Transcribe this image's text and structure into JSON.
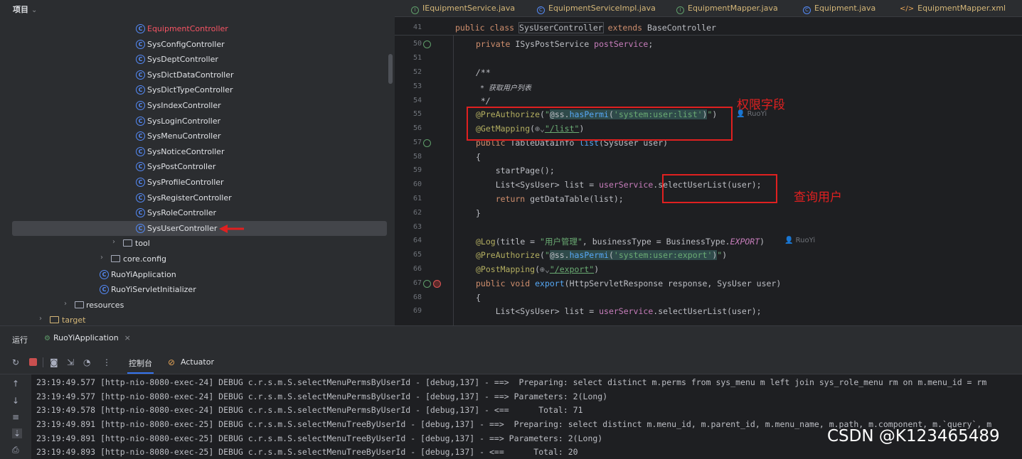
{
  "project": {
    "header": "项目",
    "items": [
      {
        "label": "EquipmentController",
        "kind": "class",
        "highlight": true
      },
      {
        "label": "SysConfigController",
        "kind": "class"
      },
      {
        "label": "SysDeptController",
        "kind": "class"
      },
      {
        "label": "SysDictDataController",
        "kind": "class"
      },
      {
        "label": "SysDictTypeController",
        "kind": "class"
      },
      {
        "label": "SysIndexController",
        "kind": "class"
      },
      {
        "label": "SysLoginController",
        "kind": "class"
      },
      {
        "label": "SysMenuController",
        "kind": "class"
      },
      {
        "label": "SysNoticeController",
        "kind": "class"
      },
      {
        "label": "SysPostController",
        "kind": "class"
      },
      {
        "label": "SysProfileController",
        "kind": "class"
      },
      {
        "label": "SysRegisterController",
        "kind": "class"
      },
      {
        "label": "SysRoleController",
        "kind": "class"
      },
      {
        "label": "SysUserController",
        "kind": "class",
        "selected": true
      },
      {
        "label": "tool",
        "kind": "folder"
      },
      {
        "label": "core.config",
        "kind": "folder"
      },
      {
        "label": "RuoYiApplication",
        "kind": "class"
      },
      {
        "label": "RuoYiServletInitializer",
        "kind": "class"
      },
      {
        "label": "resources",
        "kind": "folder"
      },
      {
        "label": "target",
        "kind": "folder"
      }
    ]
  },
  "editor": {
    "tabs": [
      {
        "label": "IEquipmentService.java",
        "icon": "interface-icon"
      },
      {
        "label": "EquipmentServiceImpl.java",
        "icon": "class-icon"
      },
      {
        "label": "EquipmentMapper.java",
        "icon": "interface-icon"
      },
      {
        "label": "Equipment.java",
        "icon": "class-icon"
      },
      {
        "label": "EquipmentMapper.xml",
        "icon": "xml-icon"
      }
    ],
    "sticky": {
      "line": "41",
      "kw1": "public class ",
      "cls": "SysUserController",
      "kw2": " extends ",
      "base": "BaseController"
    },
    "lines": {
      "l50": {
        "n": "50",
        "kw": "private ",
        "rest": "ISysPostService ",
        "fld": "postService",
        "end": ";"
      },
      "l51": {
        "n": "51"
      },
      "l52": {
        "n": "52",
        "text": "/**"
      },
      "l53": {
        "n": "53",
        "text": " * 获取用户列表"
      },
      "l54": {
        "n": "54",
        "text": " */"
      },
      "l55": {
        "n": "55",
        "an": "@PreAuthorize",
        "p1": "(",
        "q1": "\"",
        "ref": "@ss.",
        "fn": "hasPermi",
        "p2": "(",
        "str": "'system:user:list'",
        "p3": ")",
        "q2": "\"",
        "p4": ")",
        "author": "RuoYi"
      },
      "l56": {
        "n": "56",
        "an": "@GetMapping",
        "p1": "(",
        "globe": "⊕⌄",
        "str": "\"/list\"",
        "p2": ")"
      },
      "l57": {
        "n": "57",
        "kw": "public ",
        "rest": "TableDataInfo ",
        "fn": "list",
        "args": "(SysUser user)"
      },
      "l58": {
        "n": "58",
        "text": "{"
      },
      "l59": {
        "n": "59",
        "text": "    startPage();"
      },
      "l60": {
        "n": "60",
        "pre": "    List<SysUser> list = ",
        "fld": "userService",
        "call": ".selectUserList(user);"
      },
      "l61": {
        "n": "61",
        "kw": "    return ",
        "rest": "getDataTable(list);"
      },
      "l62": {
        "n": "62",
        "text": "}"
      },
      "l63": {
        "n": "63"
      },
      "l64": {
        "n": "64",
        "an": "@Log",
        "p1": "(title = ",
        "str": "\"用户管理\"",
        "p2": ", businessType = BusinessType.",
        "it": "EXPORT",
        "p3": ")",
        "author": "RuoYi"
      },
      "l65": {
        "n": "65",
        "an": "@PreAuthorize",
        "p1": "(",
        "q1": "\"",
        "ref": "@ss.",
        "fn": "hasPermi",
        "p2": "(",
        "str": "'system:user:export'",
        "p3": ")",
        "q2": "\"",
        "p4": ")"
      },
      "l66": {
        "n": "66",
        "an": "@PostMapping",
        "p1": "(",
        "globe": "⊕⌄",
        "str": "\"/export\"",
        "p2": ")"
      },
      "l67": {
        "n": "67",
        "kw": "public void ",
        "fn": "export",
        "args": "(HttpServletResponse response, SysUser user)"
      },
      "l68": {
        "n": "68",
        "text": "{"
      },
      "l69": {
        "n": "69",
        "pre": "    List<SysUser> list = ",
        "fld": "userService",
        "call": ".selectUserList(user);"
      }
    },
    "annotations": {
      "perm": "权限字段",
      "query": "查询用户"
    }
  },
  "run": {
    "title": "运行",
    "tab": "RuoYiApplication",
    "close": "×",
    "console": "控制台",
    "actuator": "Actuator",
    "logs": [
      "23:19:49.577 [http-nio-8080-exec-24] DEBUG c.r.s.m.S.selectMenuPermsByUserId - [debug,137] - ==>  Preparing: select distinct m.perms from sys_menu m left join sys_role_menu rm on m.menu_id = rm",
      "23:19:49.577 [http-nio-8080-exec-24] DEBUG c.r.s.m.S.selectMenuPermsByUserId - [debug,137] - ==> Parameters: 2(Long)",
      "23:19:49.578 [http-nio-8080-exec-24] DEBUG c.r.s.m.S.selectMenuPermsByUserId - [debug,137] - <==      Total: 71",
      "23:19:49.891 [http-nio-8080-exec-25] DEBUG c.r.s.m.S.selectMenuTreeByUserId - [debug,137] - ==>  Preparing: select distinct m.menu_id, m.parent_id, m.menu_name, m.path, m.component, m.`query`, m",
      "23:19:49.891 [http-nio-8080-exec-25] DEBUG c.r.s.m.S.selectMenuTreeByUserId - [debug,137] - ==> Parameters: 2(Long)",
      "23:19:49.893 [http-nio-8080-exec-25] DEBUG c.r.s.m.S.selectMenuTreeByUserId - [debug,137] - <==      Total: 20"
    ]
  },
  "watermark": "CSDN @K123465489"
}
